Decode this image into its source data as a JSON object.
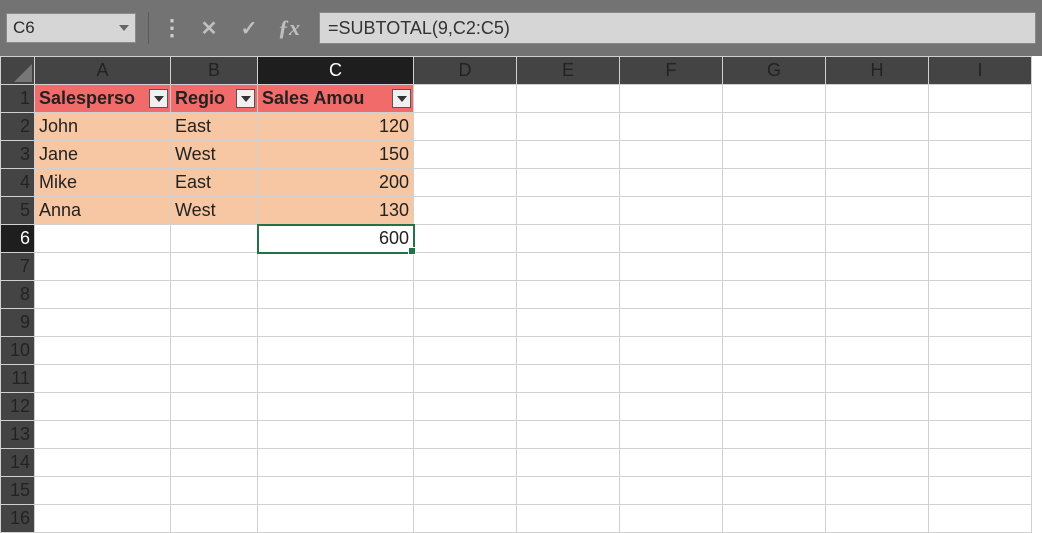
{
  "namebox": {
    "value": "C6"
  },
  "formula": "=SUBTOTAL(9,C2:C5)",
  "columns": [
    "A",
    "B",
    "C",
    "D",
    "E",
    "F",
    "G",
    "H",
    "I"
  ],
  "active": {
    "col": "C",
    "row": 6
  },
  "headers": {
    "A": "Salesperson",
    "B": "Region",
    "C": "Sales Amount"
  },
  "rows": [
    {
      "A": "John",
      "B": "East",
      "C": 120
    },
    {
      "A": "Jane",
      "B": "West",
      "C": 150
    },
    {
      "A": "Mike",
      "B": "East",
      "C": 200
    },
    {
      "A": "Anna",
      "B": "West",
      "C": 130
    }
  ],
  "c6": 600,
  "chart_data": {
    "type": "table",
    "columns": [
      "Salesperson",
      "Region",
      "Sales Amount"
    ],
    "data": [
      [
        "John",
        "East",
        120
      ],
      [
        "Jane",
        "West",
        150
      ],
      [
        "Mike",
        "East",
        200
      ],
      [
        "Anna",
        "West",
        130
      ]
    ],
    "subtotal": {
      "label": "SUBTOTAL(9)",
      "column": "Sales Amount",
      "value": 600
    }
  }
}
